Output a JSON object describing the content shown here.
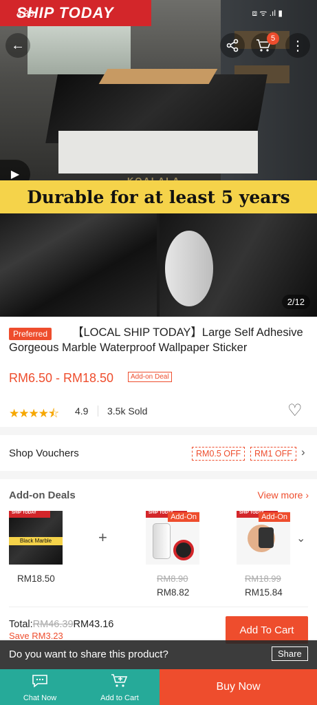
{
  "status": {
    "time": "4:36",
    "icons": "⧈ ᯤ .ıl ▮"
  },
  "hero": {
    "banner": "SHIP TODAY",
    "watermark": "KOALALA",
    "slogan": "Durable for at least 5 years",
    "image_counter": "2/12",
    "cart_count": "5"
  },
  "product": {
    "badge": "Preferred",
    "title": "【LOCAL SHIP TODAY】Large Self Adhesive Gorgeous Marble Waterproof Wallpaper Sticker",
    "price": "RM6.50 - RM18.50",
    "addon_tag": "Add-on Deal",
    "stars": "★★★★⯪",
    "rating": "4.9",
    "sold": "3.5k Sold"
  },
  "vouchers": {
    "label": "Shop Vouchers",
    "items": [
      "RM0.5 OFF",
      "RM1 OFF"
    ]
  },
  "addon": {
    "title": "Add-on Deals",
    "view_more": "View more",
    "items": [
      {
        "img_label": "Black Marble",
        "banner": "SHIP TODAY",
        "price": "RM18.50"
      },
      {
        "badge": "Add-On",
        "banner": "SHIP TODAY",
        "old_price": "RM8.90",
        "price": "RM8.82"
      },
      {
        "badge": "Add-On",
        "banner": "SHIP TODAY",
        "old_price": "RM18.99",
        "price": "RM15.84"
      }
    ],
    "total_label": "Total:",
    "total_old": "RM46.39",
    "total_new": "RM43.16",
    "save": "Save  RM3.23",
    "add_to_cart": "Add To Cart"
  },
  "share": {
    "prompt": "Do you want to share this product?",
    "button": "Share"
  },
  "bottom": {
    "chat": "Chat Now",
    "add_cart": "Add to Cart",
    "buy": "Buy Now"
  },
  "colors": {
    "accent": "#ee4d2d",
    "teal": "#26aa99",
    "banner_red": "#d3262a",
    "slogan_yellow": "#f5d34a"
  }
}
